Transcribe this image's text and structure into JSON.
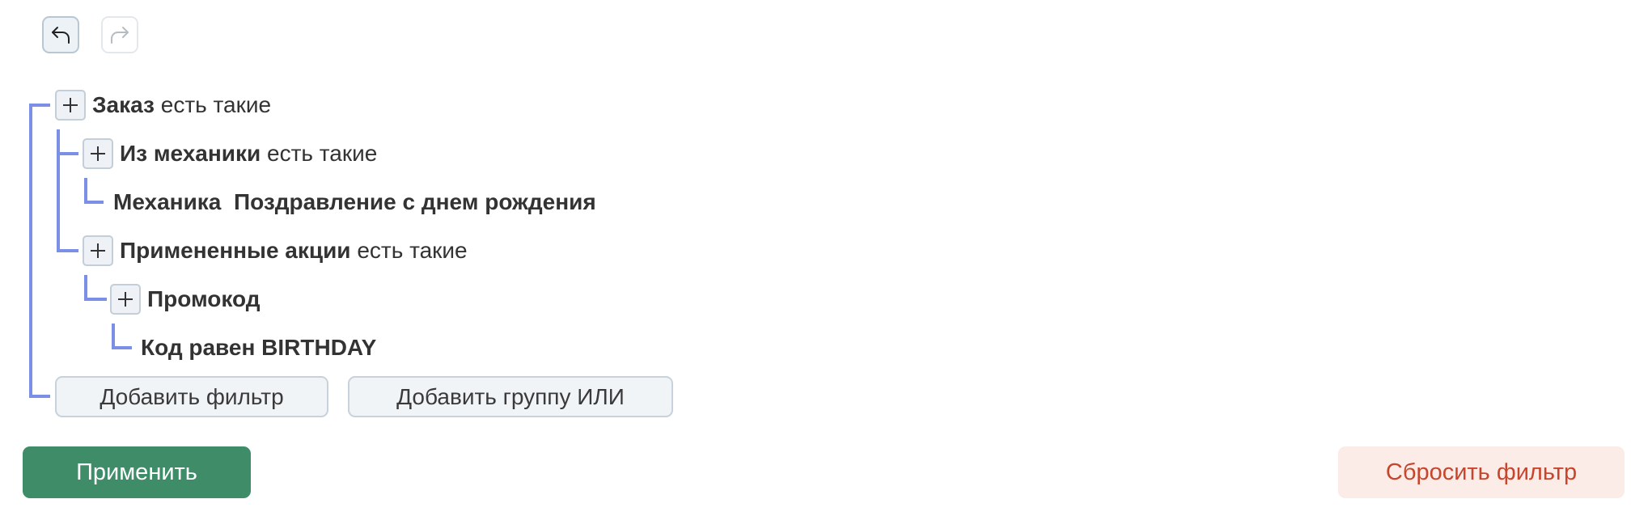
{
  "toolbar": {
    "undo_icon": "undo-arrow-icon",
    "redo_icon": "redo-arrow-icon"
  },
  "tree": {
    "order": {
      "name": "Заказ",
      "condition": "есть такие"
    },
    "mechanics": {
      "name": "Из механики",
      "condition": "есть такие"
    },
    "mechanic_value": {
      "name": "Механика",
      "value": "Поздравление с днем рождения"
    },
    "promotions": {
      "name": "Примененные акции",
      "condition": "есть такие"
    },
    "promocode": {
      "name": "Промокод"
    },
    "code_rule": {
      "text": "Код равен BIRTHDAY"
    }
  },
  "actions": {
    "add_filter": "Добавить фильтр",
    "add_or_group": "Добавить группу ИЛИ",
    "apply": "Применить",
    "reset": "Сбросить фильтр"
  },
  "colors": {
    "tree_line": "#7b8fe6",
    "apply_bg": "#3f8c69",
    "reset_bg": "#fbece8",
    "reset_text": "#c8442c"
  }
}
